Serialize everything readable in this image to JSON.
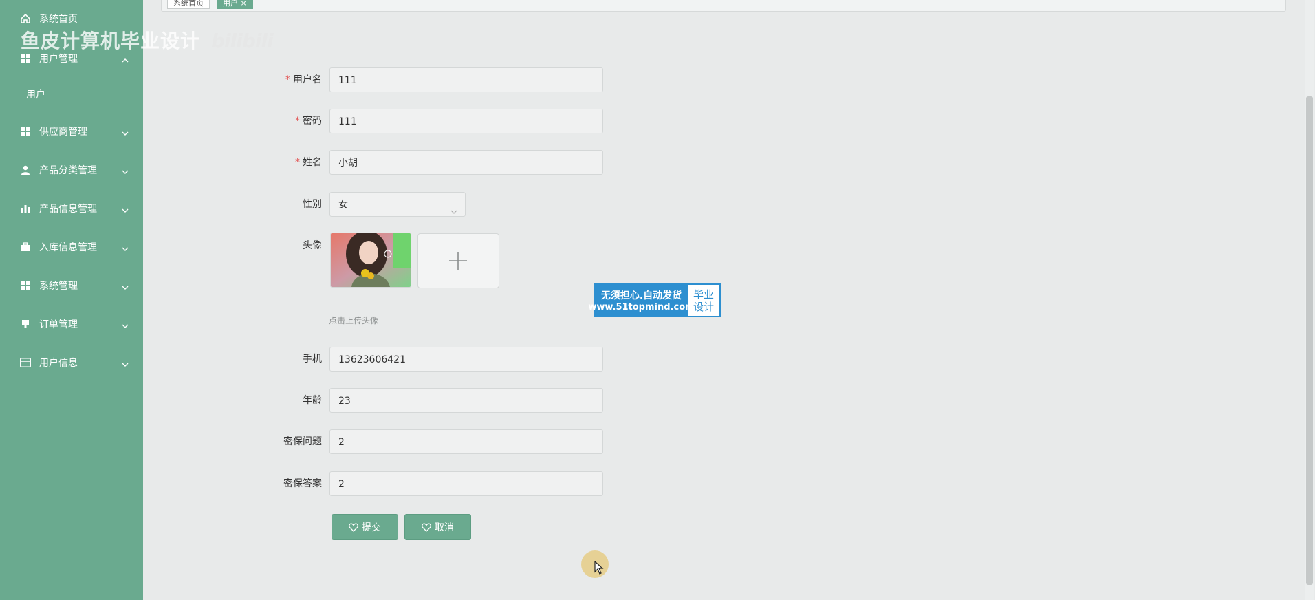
{
  "sidebar": {
    "watermark": "鱼皮计算机毕业设计",
    "watermark_logo": "bilibili",
    "items": [
      {
        "label": "系统首页",
        "icon": "home-icon"
      },
      {
        "label": "用户管理",
        "icon": "grid-icon",
        "expanded": true
      },
      {
        "label": "供应商管理",
        "icon": "grid-icon"
      },
      {
        "label": "产品分类管理",
        "icon": "person-icon"
      },
      {
        "label": "产品信息管理",
        "icon": "bar-chart-icon"
      },
      {
        "label": "入库信息管理",
        "icon": "briefcase-icon"
      },
      {
        "label": "系统管理",
        "icon": "grid-icon"
      },
      {
        "label": "订单管理",
        "icon": "stamp-icon"
      },
      {
        "label": "用户信息",
        "icon": "card-icon"
      }
    ],
    "sub_items": [
      {
        "label": "用户"
      }
    ]
  },
  "breadcrumb": {
    "items": [
      "系统首页",
      "用户 ×"
    ]
  },
  "form": {
    "username": {
      "label": "用户名",
      "value": "111",
      "required": true
    },
    "password": {
      "label": "密码",
      "value": "111",
      "required": true
    },
    "name": {
      "label": "姓名",
      "value": "小胡",
      "required": true
    },
    "gender": {
      "label": "性别",
      "value": "女"
    },
    "avatar": {
      "label": "头像",
      "hint": "点击上传头像"
    },
    "phone": {
      "label": "手机",
      "value": "13623606421"
    },
    "age": {
      "label": "年龄",
      "value": "23"
    },
    "security_question": {
      "label": "密保问题",
      "value": "2"
    },
    "security_answer": {
      "label": "密保答案",
      "value": "2"
    },
    "submit_label": "提交",
    "cancel_label": "取消"
  },
  "ad": {
    "line1": "无须担心.自动发货",
    "line2": "www.51topmind.com",
    "side1": "毕业",
    "side2": "设计"
  },
  "colors": {
    "accent": "#6aaa8f",
    "required": "#e25555",
    "ad_blue": "#2d8fd0"
  }
}
